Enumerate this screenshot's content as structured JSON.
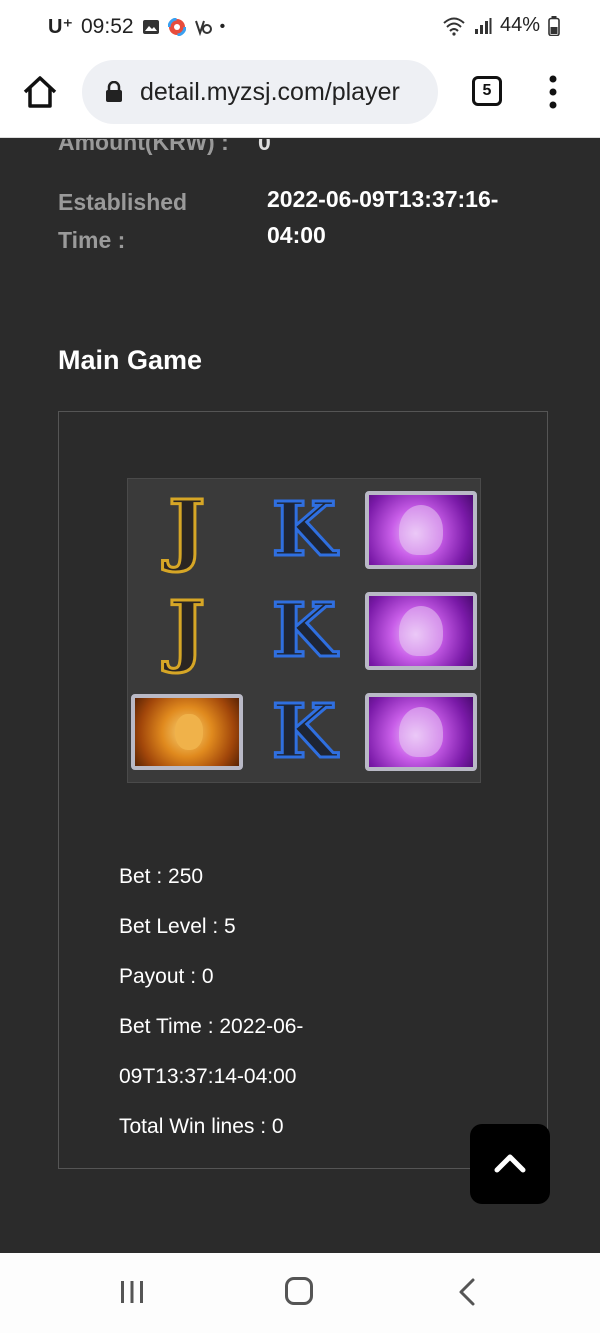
{
  "status_bar": {
    "carrier": "U⁺",
    "time": "09:52",
    "battery": "44%",
    "notification_icons": [
      "gallery-icon",
      "app-icon",
      "vpn-icon"
    ]
  },
  "browser": {
    "url": "detail.myzsj.com/player",
    "tab_count": "5"
  },
  "details_top": {
    "clipped_label": "Amount(KRW) :",
    "clipped_value": "0",
    "established_label": "Established Time :",
    "established_value": "2022-06-09T13:37:16-04:00"
  },
  "main_game": {
    "title": "Main Game",
    "reels": [
      [
        "J",
        "K",
        "owl"
      ],
      [
        "J",
        "K",
        "owl"
      ],
      [
        "lion",
        "K",
        "owl"
      ]
    ],
    "lines": [
      "Bet : 250",
      "Bet Level : 5",
      "Payout : 0",
      "Bet Time : 2022-06-",
      "09T13:37:14-04:00",
      "Total Win lines : 0"
    ]
  },
  "colors": {
    "page_bg": "#2b2b2b",
    "j_outline": "#d6a626",
    "k_outline": "#2f6fe0",
    "owl_bg": "#c85ee8"
  }
}
